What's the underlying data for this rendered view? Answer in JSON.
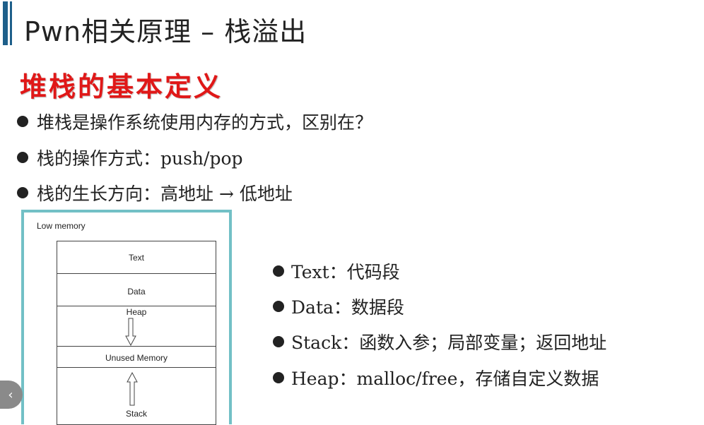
{
  "slide": {
    "title": "Pwn相关原理  –  栈溢出",
    "subtitle": "堆栈的基本定义",
    "bullets": [
      "堆栈是操作系统使用内存的方式，区别在？",
      "栈的操作方式：push/pop",
      "栈的生长方向：高地址 → 低地址"
    ],
    "diagram": {
      "low_memory": "Low memory",
      "text": "Text",
      "data": "Data",
      "heap": "Heap",
      "unused": "Unused Memory",
      "stack": "Stack"
    },
    "right_bullets": [
      "Text：代码段",
      "Data：数据段",
      "Stack：函数入参；局部变量；返回地址",
      "Heap：malloc/free，存储自定义数据"
    ]
  },
  "colors": {
    "accent": "#1e5f8a",
    "subtitle": "#e01818",
    "diagram_border": "#72c0c6"
  },
  "nav": {
    "prev_icon": "chevron-left-icon"
  }
}
